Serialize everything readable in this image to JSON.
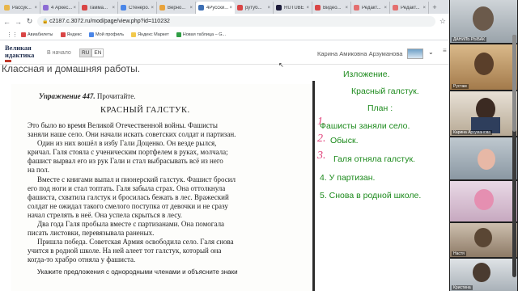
{
  "browser": {
    "tabs": [
      {
        "title": "Рассук...",
        "fav": "#e8b64b"
      },
      {
        "title": "4 Аркес...",
        "fav": "#8c6cd4"
      },
      {
        "title": "гамма...",
        "fav": "#d94545"
      },
      {
        "title": "Стенеро...",
        "fav": "#4a86e8"
      },
      {
        "title": "Верно...",
        "fav": "#e8a33c"
      },
      {
        "title": "4Русски...",
        "fav": "#3d6fb4"
      },
      {
        "title": "рутуб...",
        "fav": "#d94545"
      },
      {
        "title": "RUTUBE",
        "fav": "#1b1b3a"
      },
      {
        "title": "Видео...",
        "fav": "#d94545"
      },
      {
        "title": "Редакт...",
        "fav": "#e46f6f"
      },
      {
        "title": "Редакт...",
        "fav": "#e46f6f"
      }
    ],
    "url": "c2187.c.3072.ru/mod/page/view.php?id=110232",
    "bookmarks": [
      {
        "label": "Авиабилеты",
        "color": "#d94545"
      },
      {
        "label": "Яндекс",
        "color": "#d94545"
      },
      {
        "label": "Мой профиль",
        "color": "#4a86e8"
      },
      {
        "label": "Яндекс Маркет",
        "color": "#f2c94c"
      },
      {
        "label": "Новая таблица – G...",
        "color": "#2f9e44"
      }
    ]
  },
  "site": {
    "logo_line1": "Великая",
    "logo_line2": "идактика",
    "home_link": "В начало",
    "lang_ru": "RU",
    "lang_en": "EN",
    "user_name": "Карина Амиковна Арзуманова",
    "page_title": "Классная и домашняя работы."
  },
  "textbook": {
    "exercise_label": "Упражнение 447.",
    "exercise_task": "Прочитайте.",
    "title": "КРАСНЫЙ ГАЛСТУК.",
    "lines": [
      "Это было во время Великой Отечественной войны. Фашисты",
      "заняли наше село. Они начали искать советских солдат и партизан.",
      "Один из них вошёл в избу Гали Доценко. Он везде рылся,",
      "кричал. Галя стояла с ученическим портфелем в руках, молчала;",
      "фашист вырвал его из рук Гали и стал выбрасывать всё из него",
      "на пол.",
      "Вместе с книгами выпал и пионерский галстук. Фашист бросил",
      "его под ноги и стал топтать. Галя забыла страх. Она оттолкнула",
      "фашиста, схватила галстук и бросилась бежать в лес. Вражеский",
      "солдат не ожидал такого смелого поступка от девочки и не сразу",
      "начал стрелять в неё. Она успела скрыться в лесу.",
      "Два года Галя пробыла вместе с партизанами. Она помогала",
      "писать листовки, перевязывала раненых.",
      "Пришла победа. Советская Армия освободила село. Галя снова",
      "учится в родной школе. На ней алеет тот галстук, который она",
      "когда-то храбро отняла у фашиста.",
      "Укажите предложения с однородными членами и объясните знаки"
    ]
  },
  "notes": {
    "heading": "Изложение.",
    "subtitle": "Красный галстук.",
    "plan_label": "План :",
    "items": [
      "Фашисты заняли село.",
      "Обыск.",
      "Галя отняла галстук.",
      "4. У партизан.",
      "5. Снова в родной школе."
    ],
    "handwritten_numbers": [
      "1.",
      "2.",
      "3."
    ],
    "colors": {
      "text": "#1c8a1c",
      "handwriting": "#e0407a"
    }
  },
  "video": {
    "participants": [
      "ДАНИЛЬ РЫБАК",
      "Рустам",
      "Карина Арзуманова",
      "",
      "",
      "Настя",
      "Кристина"
    ]
  }
}
